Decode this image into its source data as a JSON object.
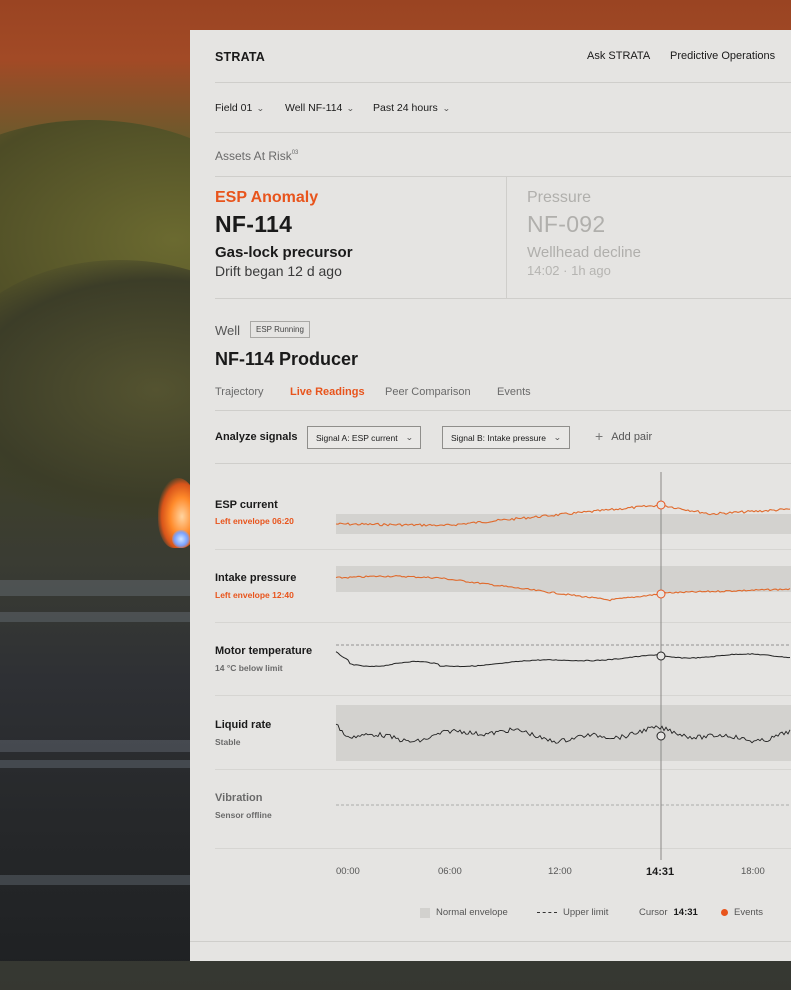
{
  "colors": {
    "accent": "#e8541c",
    "panel": "#e5e4e2",
    "text": "#1a1a1a"
  },
  "header": {
    "brand": "STRATA",
    "nav": [
      "Ask STRATA",
      "Predictive Operations"
    ]
  },
  "filters": [
    {
      "label": "Field 01",
      "icon": "chevron-down-icon"
    },
    {
      "label": "Well NF-114",
      "icon": "chevron-down-icon"
    },
    {
      "label": "Past 24 hours",
      "icon": "chevron-down-icon"
    }
  ],
  "risk": {
    "title": "Assets At Risk",
    "count": "03"
  },
  "cards": [
    {
      "category": "ESP Anomaly",
      "id": "NF-114",
      "description": "Gas-lock precursor",
      "detail": "Drift began 12 d ago",
      "active": true
    },
    {
      "category": "Pressure",
      "id": "NF-092",
      "description": "Wellhead decline",
      "detail": "14:02 · 1h ago",
      "active": false
    }
  ],
  "well": {
    "label": "Well",
    "status": "ESP Running",
    "name": "NF-114 Producer",
    "tabs": [
      "Trajectory",
      "Live Readings",
      "Peer Comparison",
      "Events"
    ],
    "active_tab": 1
  },
  "analyze": {
    "label": "Analyze signals",
    "signal_a": "Signal A: ESP current",
    "signal_b": "Signal B: Intake pressure",
    "add_pair": "Add pair"
  },
  "signals": [
    {
      "name": "ESP current",
      "status": "Left envelope 06:20",
      "alert": true
    },
    {
      "name": "Intake pressure",
      "status": "Left envelope 12:40",
      "alert": true
    },
    {
      "name": "Motor temperature",
      "status": "14 °C below limit",
      "alert": false
    },
    {
      "name": "Liquid rate",
      "status": "Stable",
      "alert": false
    },
    {
      "name": "Vibration",
      "status": "Sensor offline",
      "alert": false,
      "offline": true
    }
  ],
  "time_axis": {
    "ticks": [
      "00:00",
      "06:00",
      "12:00",
      "14:31",
      "18:00"
    ],
    "cursor": "14:31"
  },
  "legend": {
    "envelope": "Normal envelope",
    "upper_limit": "Upper limit",
    "cursor_label": "Cursor",
    "cursor_value": "14:31",
    "events": "Events"
  }
}
